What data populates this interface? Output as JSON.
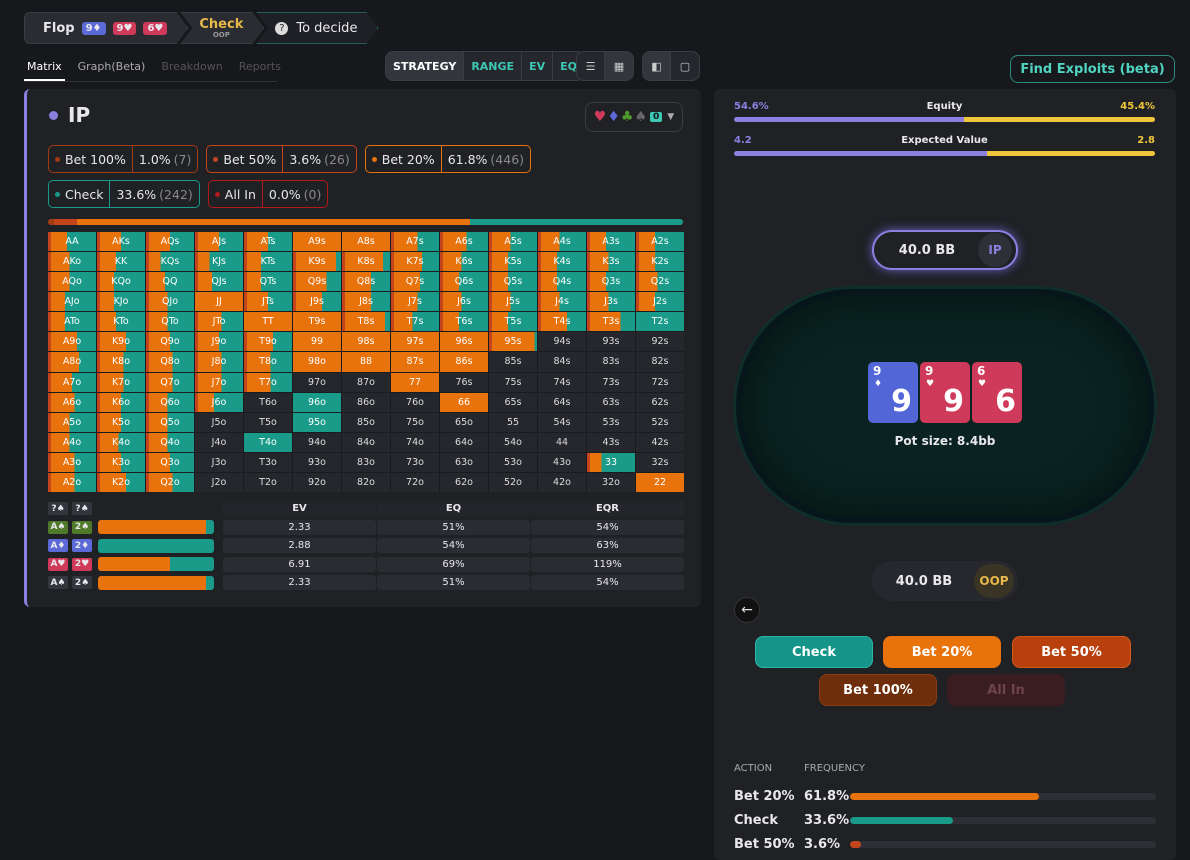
{
  "breadcrumb": {
    "street": "Flop",
    "board": [
      {
        "rank": "9",
        "suit": "♦",
        "color": "#5b6ad6"
      },
      {
        "rank": "9",
        "suit": "♥",
        "color": "#d03a5a"
      },
      {
        "rank": "6",
        "suit": "♥",
        "color": "#d03a5a"
      }
    ],
    "action": "Check",
    "action_pos": "OOP",
    "decide": "To decide"
  },
  "view_tabs": [
    "Matrix",
    "Graph(Beta)",
    "Breakdown",
    "Reports"
  ],
  "mode_tabs": [
    "STRATEGY",
    "RANGE",
    "EV",
    "EQ"
  ],
  "find_exploits": "Find Exploits (beta)",
  "player": "IP",
  "suit_filter": {
    "badge": "0"
  },
  "actions": [
    {
      "key": "b100",
      "label": "Bet 100%",
      "pct": "1.0%",
      "count": "(7)",
      "color": "#a23b12"
    },
    {
      "key": "b50",
      "label": "Bet 50%",
      "pct": "3.6%",
      "count": "(26)",
      "color": "#c4441b"
    },
    {
      "key": "b20",
      "label": "Bet 20%",
      "pct": "61.8%",
      "count": "(446)",
      "color": "#e8720c"
    },
    {
      "key": "chk",
      "label": "Check",
      "pct": "33.6%",
      "count": "(242)",
      "color": "#1a9a88"
    },
    {
      "key": "allin",
      "label": "All In",
      "pct": "0.0%",
      "count": "(0)",
      "color": "#b01a1a"
    }
  ],
  "strategy_mix": {
    "b100": 1.0,
    "b50": 3.6,
    "b20": 61.8,
    "chk": 33.6
  },
  "matrix": {
    "ranks": [
      "A",
      "K",
      "Q",
      "J",
      "T",
      "9",
      "8",
      "7",
      "6",
      "5",
      "4",
      "3",
      "2"
    ],
    "rows": [
      [
        0.4,
        0.5,
        0.5,
        0.5,
        0.5,
        1,
        1,
        0.55,
        0.55,
        0.45,
        0.45,
        0.4,
        0.4
      ],
      [
        0.45,
        0.4,
        0.3,
        0.3,
        0.35,
        0.9,
        0.85,
        0.65,
        0.45,
        0.4,
        0.4,
        0.45,
        0.4
      ],
      [
        0.45,
        0.35,
        0.4,
        0.35,
        0.35,
        0.7,
        0.6,
        0.6,
        0.4,
        0.4,
        0.4,
        0.4,
        0.45
      ],
      [
        0.35,
        0.35,
        0.45,
        1,
        0.5,
        0.6,
        0.6,
        0.55,
        0.45,
        0.45,
        0.45,
        0.45,
        0.4
      ],
      [
        0.35,
        0.4,
        0.45,
        0.55,
        1,
        1,
        0.9,
        0.45,
        0.4,
        0.4,
        0.6,
        0.7,
        0
      ],
      [
        0.6,
        0.6,
        0.5,
        0.5,
        0.6,
        1,
        1,
        1,
        1,
        0.95,
        0,
        0,
        0
      ],
      [
        0.65,
        0.55,
        0.55,
        0.55,
        0.55,
        1,
        1,
        1,
        1,
        0,
        0,
        0,
        0
      ],
      [
        0.5,
        0.55,
        0.55,
        0.55,
        0.55,
        0,
        0,
        1,
        0,
        0,
        0,
        0,
        0
      ],
      [
        0.55,
        0.5,
        0.45,
        0.4,
        0,
        0,
        0,
        0,
        1,
        0,
        0,
        0,
        0
      ],
      [
        0.45,
        0.5,
        0.45,
        0,
        0,
        0,
        0,
        0,
        0,
        0,
        0,
        0,
        0
      ],
      [
        0.45,
        0.45,
        0.45,
        0,
        0,
        0,
        0,
        0,
        0,
        0,
        0,
        0,
        0
      ],
      [
        0.55,
        0.5,
        0.5,
        0,
        0,
        0,
        0,
        0,
        0,
        0,
        0,
        0.3,
        0
      ],
      [
        0.55,
        0.6,
        0.55,
        0,
        0,
        0,
        0,
        0,
        0,
        0,
        0,
        0,
        1
      ]
    ],
    "checkonly": [
      [
        4,
        12
      ],
      [
        8,
        5
      ],
      [
        9,
        5
      ],
      [
        10,
        4
      ]
    ]
  },
  "combos": {
    "headers": [
      "EV",
      "EQ",
      "EQR"
    ],
    "filter": [
      "?",
      "?"
    ],
    "rows": [
      {
        "c1": {
          "t": "A♠",
          "bg": "#4e7a2a"
        },
        "c2": {
          "t": "2♠",
          "bg": "#4e7a2a"
        },
        "bet": 0.93,
        "ev": "2.33",
        "eq": "51%",
        "eqr": "54%"
      },
      {
        "c1": {
          "t": "A♦",
          "bg": "#5b6ad6"
        },
        "c2": {
          "t": "2♦",
          "bg": "#5b6ad6"
        },
        "bet": 0,
        "ev": "2.88",
        "eq": "54%",
        "eqr": "63%"
      },
      {
        "c1": {
          "t": "A♥",
          "bg": "#d03a5a"
        },
        "c2": {
          "t": "2♥",
          "bg": "#d03a5a"
        },
        "bet": 0.62,
        "ev": "6.91",
        "eq": "69%",
        "eqr": "119%"
      },
      {
        "c1": {
          "t": "A♠",
          "bg": "#33363d"
        },
        "c2": {
          "t": "2♠",
          "bg": "#33363d"
        },
        "bet": 0.93,
        "ev": "2.33",
        "eq": "51%",
        "eqr": "54%"
      }
    ]
  },
  "equity": {
    "label": "Equity",
    "left": "54.6%",
    "right": "45.4%",
    "split": 54.6
  },
  "ev": {
    "label": "Expected Value",
    "left": "4.2",
    "right": "2.8",
    "split": 60
  },
  "players": {
    "ip": {
      "stack": "40.0 BB",
      "pos": "IP"
    },
    "oop": {
      "stack": "40.0 BB",
      "pos": "OOP"
    }
  },
  "pot": "Pot size: 8.4bb",
  "buttons": {
    "check": "Check",
    "b20": "Bet 20%",
    "b50": "Bet 50%",
    "b100": "Bet 100%",
    "allin": "All In"
  },
  "freq": {
    "h_action": "ACTION",
    "h_freq": "FREQUENCY",
    "rows": [
      {
        "name": "Bet 20%",
        "pct": "61.8%",
        "v": 61.8,
        "color": "#e8720c"
      },
      {
        "name": "Check",
        "pct": "33.6%",
        "v": 33.6,
        "color": "#1a9a88"
      },
      {
        "name": "Bet 50%",
        "pct": "3.6%",
        "v": 3.6,
        "color": "#c4441b"
      }
    ]
  }
}
